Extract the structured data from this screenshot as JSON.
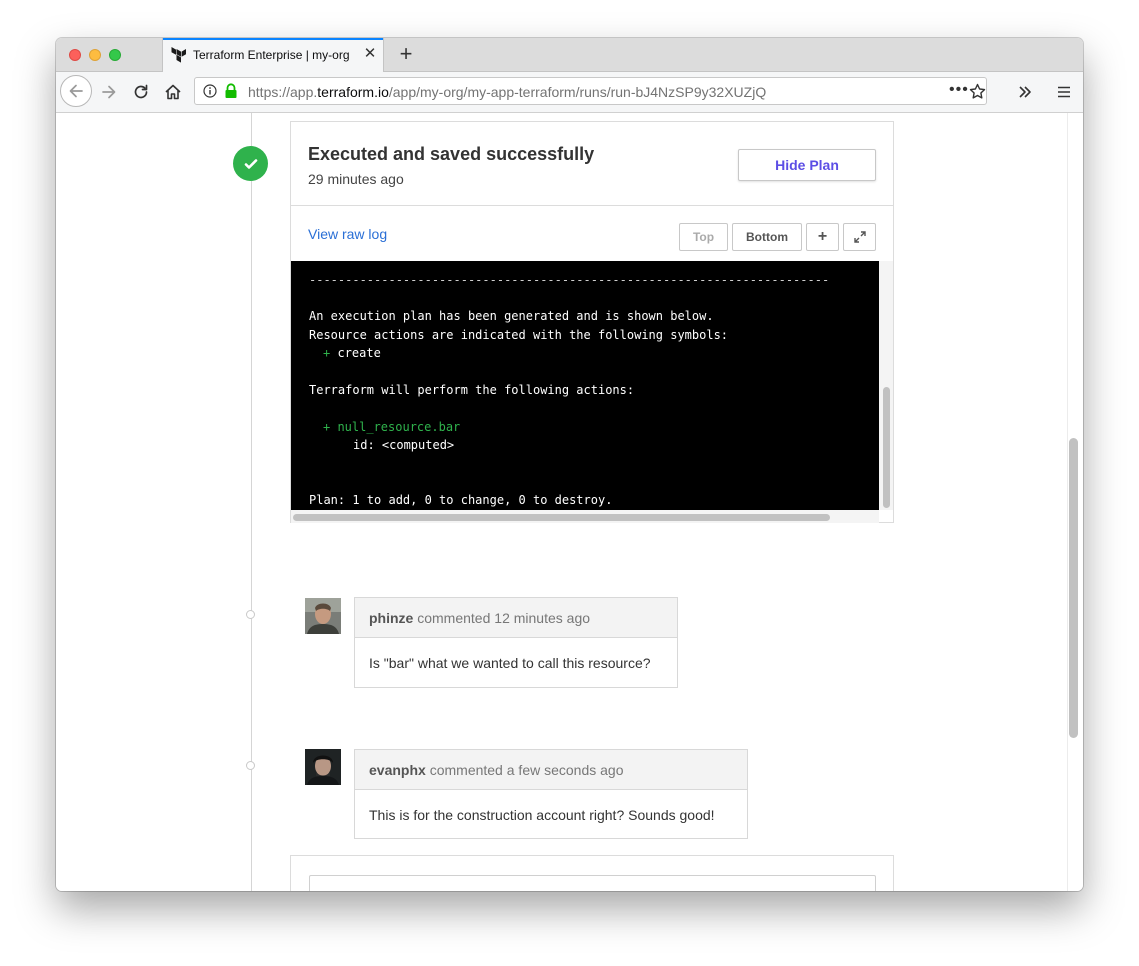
{
  "browser": {
    "tab_title": "Terraform Enterprise | my-org | my-app-terraform",
    "url_prefix": "https://app.",
    "url_domain": "terraform.io",
    "url_path": "/app/my-org/my-app-terraform/runs/run-bJ4NzSP9y32XUZjQ",
    "accent_color": "#0a84ff"
  },
  "run": {
    "status_title": "Executed and saved successfully",
    "status_time": "29 minutes ago",
    "hide_plan_label": "Hide Plan",
    "view_raw_log_label": "View raw log",
    "top_label": "Top",
    "bottom_label": "Bottom",
    "expand_label": "+",
    "fullscreen_icon": "expand-arrows-icon",
    "status_color": "#2fb24c"
  },
  "log": {
    "divider": "------------------------------------------------------------------------",
    "line1": "An execution plan has been generated and is shown below.",
    "line2": "Resource actions are indicated with the following symbols:",
    "create_symbol": "+",
    "create_label": "create",
    "line3": "Terraform will perform the following actions:",
    "resource": "+ null_resource.bar",
    "attribute": "id: <computed>",
    "summary": "Plan: 1 to add, 0 to change, 0 to destroy."
  },
  "comments": [
    {
      "author": "phinze",
      "action": "commented",
      "time": "12 minutes ago",
      "body": "Is \"bar\" what we wanted to call this resource?"
    },
    {
      "author": "evanphx",
      "action": "commented",
      "time": "a few seconds ago",
      "body": "This is for the construction account right? Sounds good!"
    }
  ]
}
